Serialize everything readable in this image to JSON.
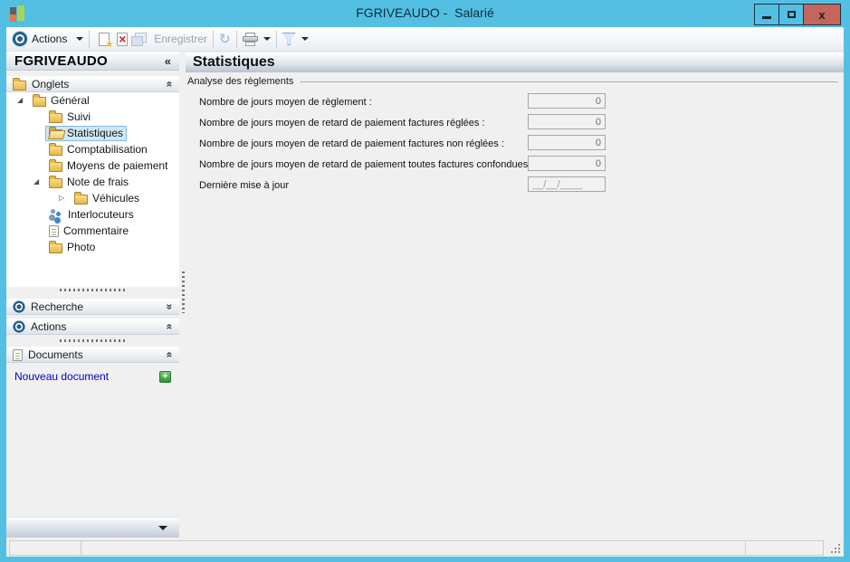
{
  "window": {
    "title": "FGRIVEAUDO -  Salarié",
    "controls": {
      "minimize": "minimize",
      "maximize": "maximize",
      "close": "x"
    }
  },
  "toolbar": {
    "actions_label": "Actions",
    "save_label": "Enregistrer"
  },
  "sidebar": {
    "header": {
      "title": "FGRIVEAUDO",
      "collapse_glyph": "«"
    },
    "panels": {
      "onglets": {
        "label": "Onglets",
        "chevron": "«"
      },
      "recherche": {
        "label": "Recherche",
        "chevron": "»"
      },
      "actions": {
        "label": "Actions",
        "chevron": "«"
      },
      "documents": {
        "label": "Documents",
        "chevron": "«"
      }
    },
    "tree": [
      {
        "label": "Général",
        "classes": "ind0",
        "twisty": "◢",
        "icon": "icon-folder"
      },
      {
        "label": "Suivi",
        "classes": "ind1",
        "twisty": "",
        "icon": "icon-folder"
      },
      {
        "label": "Statistiques",
        "classes": "ind1 selected",
        "twisty": "",
        "icon": "icon-folder-open"
      },
      {
        "label": "Comptabilisation",
        "classes": "ind1",
        "twisty": "",
        "icon": "icon-folder"
      },
      {
        "label": "Moyens de paiement",
        "classes": "ind1",
        "twisty": "",
        "icon": "icon-folder"
      },
      {
        "label": "Note de frais",
        "classes": "ind1",
        "twisty": "◢",
        "icon": "icon-folder"
      },
      {
        "label": "Véhicules",
        "classes": "ind2",
        "twisty": "▷",
        "icon": "icon-folder"
      },
      {
        "label": "Interlocuteurs",
        "classes": "ind1",
        "twisty": "",
        "icon": "icon-people"
      },
      {
        "label": "Commentaire",
        "classes": "ind1",
        "twisty": "",
        "icon": "icon-note"
      },
      {
        "label": "Photo",
        "classes": "ind1",
        "twisty": "",
        "icon": "icon-folder"
      }
    ],
    "new_document": {
      "label": "Nouveau document",
      "plus_glyph": "+"
    }
  },
  "main": {
    "title": "Statistiques",
    "group_label": "Analyse des règlements",
    "fields": [
      {
        "label": "Nombre de jours moyen de règlement :",
        "value": "0",
        "classes": "num"
      },
      {
        "label": "Nombre de jours moyen de retard de paiement factures réglées :",
        "value": "0",
        "classes": "num"
      },
      {
        "label": "Nombre de jours moyen de retard de paiement factures non réglées :",
        "value": "0",
        "classes": "num"
      },
      {
        "label": "Nombre de jours moyen de retard de paiement toutes factures confondues :",
        "value": "0",
        "classes": "num"
      },
      {
        "label": "Dernière mise à jour",
        "value": "__/__/____",
        "classes": "date"
      }
    ]
  },
  "colors": {
    "titlebar": "#53bfe2",
    "close_button": "#c5655c",
    "selection_bg": "#cfe8f8",
    "selection_border": "#86b8d8",
    "link": "#0000cc",
    "folder": "#e8b84d"
  }
}
